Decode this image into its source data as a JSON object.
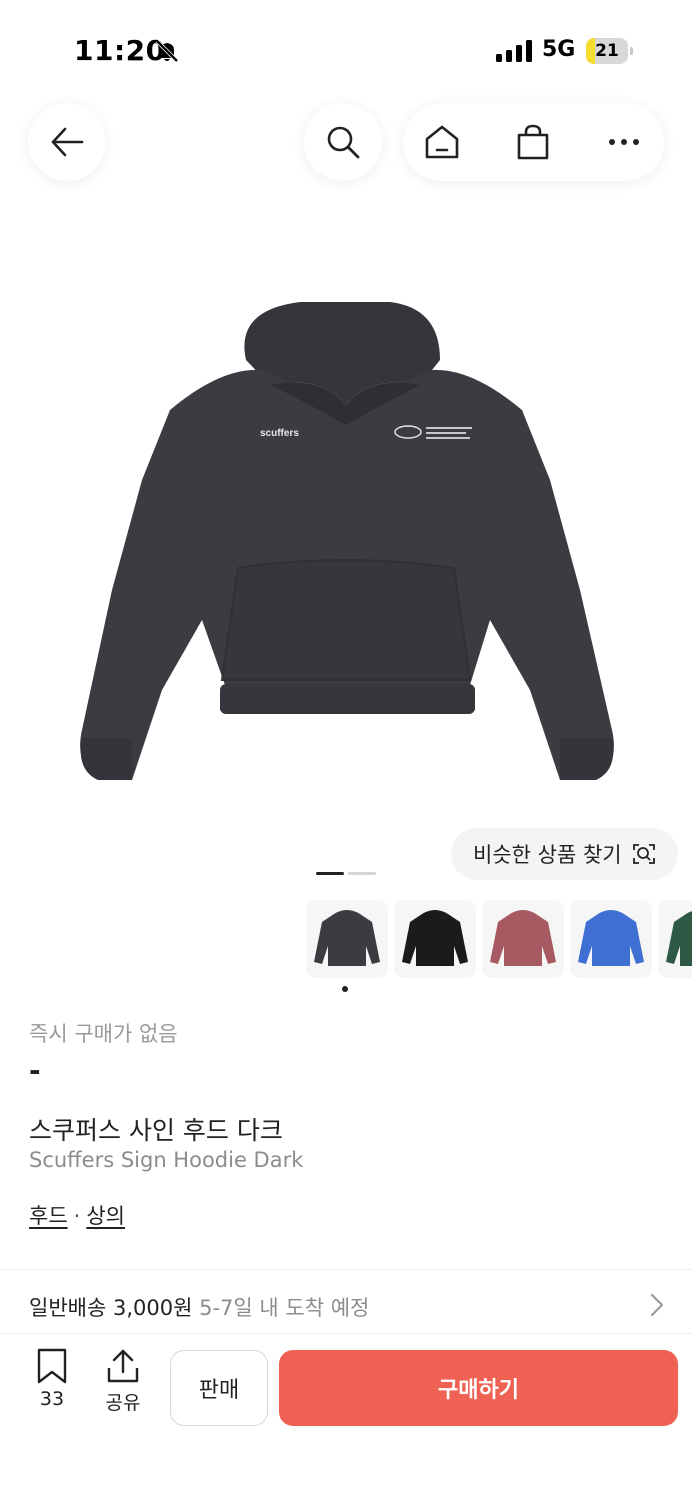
{
  "status_bar": {
    "time": "11:20",
    "network": "5G",
    "battery": "21",
    "battery_percent": 21
  },
  "nav": {
    "back_icon": "arrow-left-icon",
    "search_icon": "search-icon",
    "home_icon": "home-icon",
    "bag_icon": "shopping-bag-icon",
    "more_icon": "more-horizontal-icon"
  },
  "product": {
    "image_logo_text": "scuffers",
    "similar_button": "비슷한 상품 찾기",
    "thumbnails": [
      {
        "color": "#3c3b42",
        "name": "dark"
      },
      {
        "color": "#1b1b1d",
        "name": "black"
      },
      {
        "color": "#a85a62",
        "name": "rose"
      },
      {
        "color": "#3f6fd2",
        "name": "blue"
      },
      {
        "color": "#2e5a45",
        "name": "green"
      }
    ],
    "price_label": "즉시 구매가 없음",
    "price_value": "-",
    "title_ko": "스쿠퍼스 사인 후드 다크",
    "title_en": "Scuffers Sign Hoodie Dark",
    "category_1": "후드",
    "category_sep": "·",
    "category_2": "상의"
  },
  "shipping": {
    "label": "일반배송 3,000원",
    "eta": "5-7일 내 도착 예정"
  },
  "bottom_bar": {
    "bookmark_count": "33",
    "share_label": "공유",
    "sell_label": "판매",
    "buy_label": "구매하기"
  },
  "colors": {
    "accent": "#ef6253",
    "hoodie": "#3c3b42"
  }
}
